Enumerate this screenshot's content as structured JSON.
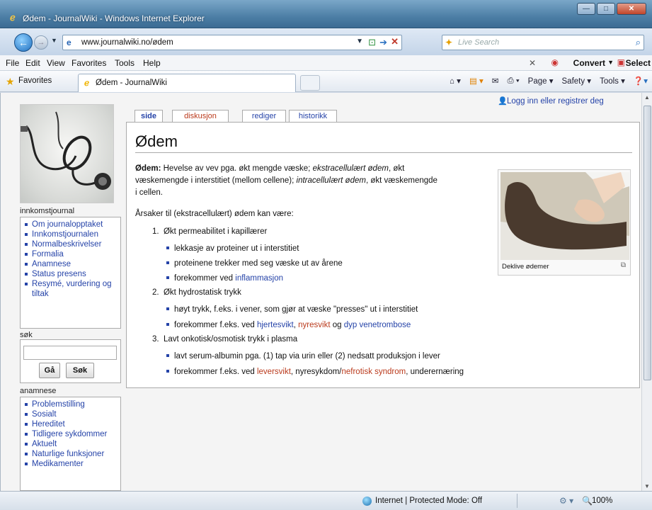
{
  "window": {
    "title": "Ødem - JournalWiki - Windows Internet Explorer",
    "buttons": [
      "—",
      "□",
      "✕"
    ]
  },
  "address": {
    "url": "www.journalwiki.no/ødem",
    "search_placeholder": "Live Search"
  },
  "menu": {
    "items": [
      "File",
      "Edit",
      "View",
      "Favorites",
      "Tools",
      "Help"
    ],
    "convert": "Convert",
    "select": "Select"
  },
  "favbar": {
    "favorites_label": "Favorites",
    "tab_label": "Ødem - JournalWiki"
  },
  "cmdbar": {
    "page": "Page",
    "safety": "Safety",
    "tools": "Tools"
  },
  "wiki": {
    "login": "Logg inn eller registrer deg",
    "tabs": [
      "side",
      "diskusjon",
      "rediger",
      "historikk"
    ],
    "title": "Ødem",
    "def_bold": "Ødem:",
    "def_text1": " Hevelse av vev pga. økt mengde væske; ",
    "def_italic1": "ekstracellulært ødem",
    "def_text2": ", økt",
    "def_line2a": "væskemengde i interstitiet (mellom cellene); ",
    "def_italic2": "intracellulært ødem",
    "def_line2b": ", økt væskemengde",
    "def_line3": "i cellen.",
    "causes_intro": "Årsaker til (ekstracellulært) ødem kan være:",
    "cause1": "Økt permeabilitet i kapillærer",
    "cause1_b1": "lekkasje av proteiner ut i interstitiet",
    "cause1_b2": "proteinene trekker med seg væske ut av årene",
    "cause1_b3_pre": "forekommer ved ",
    "cause1_b3_link": "inflammasjon",
    "cause2": "Økt hydrostatisk trykk",
    "cause2_b1": "høyt trykk, f.eks. i vener, som gjør at væske \"presses\" ut i interstitiet",
    "cause2_b2_pre": "forekommer f.eks. ved ",
    "cause2_b2_l1": "hjertesvikt",
    "cause2_b2_sep1": ", ",
    "cause2_b2_l2": "nyresvikt",
    "cause2_b2_sep2": " og ",
    "cause2_b2_l3": "dyp venetrombose",
    "cause3": "Lavt onkotisk/osmotisk trykk i plasma",
    "cause3_b1": "lavt serum-albumin pga. (1) tap via urin eller (2) nedsatt produksjon i lever",
    "cause3_b2_pre": "forekommer f.eks. ved ",
    "cause3_b2_l1": "leversvikt",
    "cause3_b2_mid": ", nyresykdom/",
    "cause3_b2_l2": "nefrotisk syndrom",
    "cause3_b2_post": ", underernæring",
    "thumb_caption": "Deklive ødemer"
  },
  "sidebar": {
    "section1_head": "innkomstjournal",
    "section1_items": [
      "Om journalopptaket",
      "Innkomstjournalen",
      "Normalbeskrivelser",
      "Formalia",
      "Anamnese",
      "Status presens",
      "Resymé, vurdering og tiltak"
    ],
    "search_head": "søk",
    "go_label": "Gå",
    "search_label": "Søk",
    "section2_head": "anamnese",
    "section2_items": [
      "Problemstilling",
      "Sosialt",
      "Hereditet",
      "Tidligere sykdommer",
      "Aktuelt",
      "Naturlige funksjoner",
      "Medikamenter"
    ]
  },
  "status": {
    "zone": "Internet | Protected Mode: Off",
    "zoom": "100%"
  },
  "colors": {
    "link": "#2543a8",
    "redlink": "#ba3a1c",
    "chrome": "#4d7fa6"
  }
}
